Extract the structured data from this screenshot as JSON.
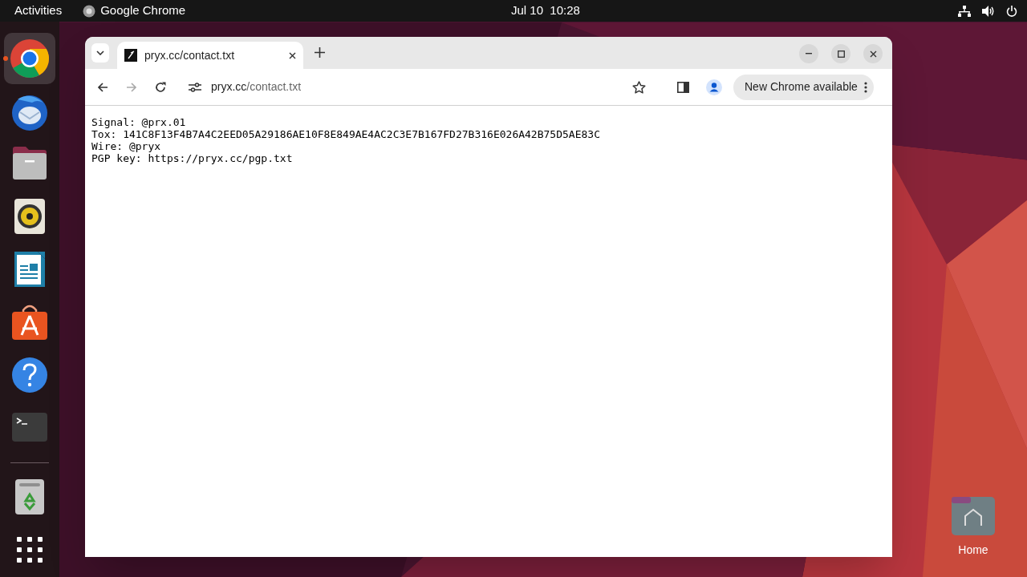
{
  "top_bar": {
    "activities": "Activities",
    "app_name": "Google Chrome",
    "clock": "Jul 10  10:28"
  },
  "dock": [
    {
      "kind": "chrome",
      "selected": true
    },
    {
      "kind": "mail",
      "selected": false
    },
    {
      "kind": "files",
      "selected": false
    },
    {
      "kind": "music",
      "selected": false
    },
    {
      "kind": "writer",
      "selected": false
    },
    {
      "kind": "store",
      "selected": false
    },
    {
      "kind": "help",
      "selected": false
    },
    {
      "kind": "terminal",
      "selected": false
    },
    {
      "kind": "divider"
    },
    {
      "kind": "trash",
      "selected": false
    },
    {
      "kind": "apps",
      "selected": false
    }
  ],
  "browser": {
    "tabs": [
      {
        "title": "pryx.cc/contact.txt",
        "selected": true
      }
    ],
    "address": {
      "host": "pryx.cc",
      "path": "/contact.txt"
    },
    "update_button": "New Chrome available",
    "content_lines": [
      "Signal: @prx.01",
      "Tox: 141C8F13F4B7A4C2EED05A29186AE10F8E849AE4AC2C3E7B167FD27B316E026A42B75D5AE83C",
      "Wire: @pryx",
      "PGP key: https://pryx.cc/pgp.txt"
    ]
  },
  "desktop_icons": [
    {
      "label": "Home"
    }
  ]
}
